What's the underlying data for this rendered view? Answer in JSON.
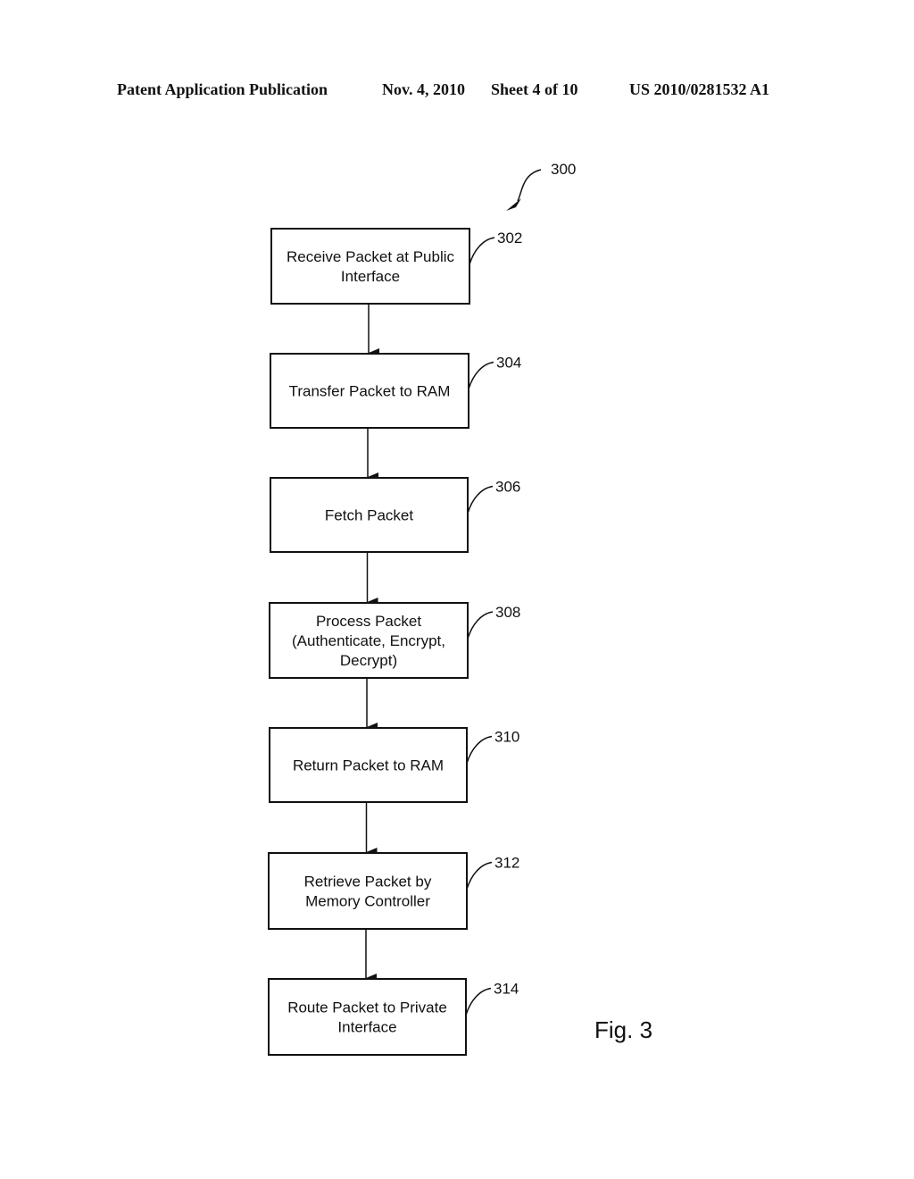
{
  "header": {
    "left": "Patent Application Publication",
    "date": "Nov. 4, 2010",
    "sheet": "Sheet 4 of 10",
    "number": "US 2010/0281532 A1"
  },
  "diagram": {
    "ref_main": "300",
    "figure_label": "Fig. 3",
    "steps": [
      {
        "ref": "302",
        "lines": [
          "Receive Packet at Public",
          "Interface"
        ]
      },
      {
        "ref": "304",
        "lines": [
          "Transfer Packet to RAM"
        ]
      },
      {
        "ref": "306",
        "lines": [
          "Fetch Packet"
        ]
      },
      {
        "ref": "308",
        "lines": [
          "Process Packet",
          "(Authenticate, Encrypt,",
          "Decrypt)"
        ]
      },
      {
        "ref": "310",
        "lines": [
          "Return Packet to RAM"
        ]
      },
      {
        "ref": "312",
        "lines": [
          "Retrieve Packet by",
          "Memory Controller"
        ]
      },
      {
        "ref": "314",
        "lines": [
          "Route Packet to Private",
          "Interface"
        ]
      }
    ]
  }
}
